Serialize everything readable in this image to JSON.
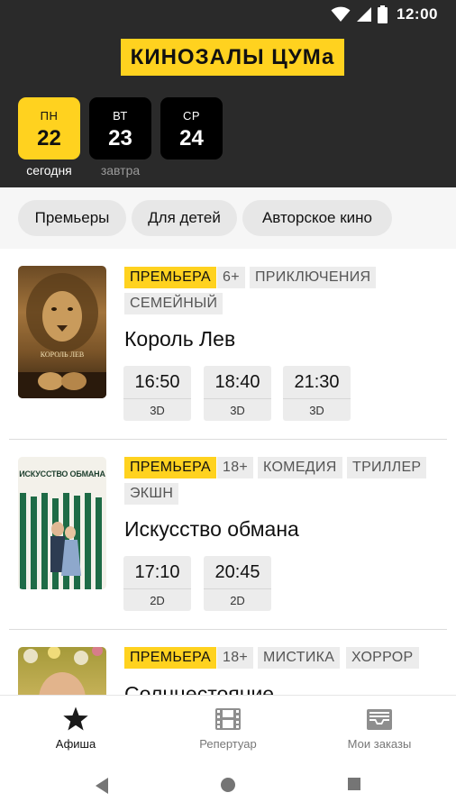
{
  "status_bar": {
    "time": "12:00",
    "wifi_icon": "wifi-icon",
    "signal_icon": "signal-icon",
    "battery_icon": "battery-icon"
  },
  "app": {
    "logo_text": "КИНОЗАЛЫ ЦУМа",
    "accent_color": "#ffd21f",
    "header_bg": "#2a2a2a"
  },
  "days": [
    {
      "dow": "ПН",
      "num": "22",
      "sub": "сегодня",
      "selected": true
    },
    {
      "dow": "ВТ",
      "num": "23",
      "sub": "завтра",
      "selected": false
    },
    {
      "dow": "СР",
      "num": "24",
      "sub": "",
      "selected": false
    }
  ],
  "filters": [
    "Премьеры",
    "Для детей",
    "Авторское кино"
  ],
  "movies": [
    {
      "title": "Король Лев",
      "tags": [
        "ПРЕМЬЕРА",
        "6+",
        "ПРИКЛЮЧЕНИЯ",
        "СЕМЕЙНЫЙ"
      ],
      "poster_text": "КОРОЛЬ ЛЕВ",
      "sessions": [
        {
          "time": "16:50",
          "format": "3D"
        },
        {
          "time": "18:40",
          "format": "3D"
        },
        {
          "time": "21:30",
          "format": "3D"
        }
      ]
    },
    {
      "title": "Искусство обмана",
      "tags": [
        "ПРЕМЬЕРА",
        "18+",
        "КОМЕДИЯ",
        "ТРИЛЛЕР",
        "ЭКШН"
      ],
      "poster_text": "ИСКУССТВО ОБМАНА",
      "sessions": [
        {
          "time": "17:10",
          "format": "2D"
        },
        {
          "time": "20:45",
          "format": "2D"
        }
      ]
    },
    {
      "title": "Солнцестояние",
      "tags": [
        "ПРЕМЬЕРА",
        "18+",
        "МИСТИКА",
        "ХОРРОР"
      ],
      "sessions": []
    }
  ],
  "bottom_nav": [
    {
      "label": "Афиша",
      "icon": "star-icon",
      "active": true
    },
    {
      "label": "Репертуар",
      "icon": "film-icon",
      "active": false
    },
    {
      "label": "Мои заказы",
      "icon": "orders-icon",
      "active": false
    }
  ],
  "system_nav": {
    "back_icon": "back-icon",
    "home_icon": "home-icon",
    "recents_icon": "recents-icon"
  }
}
